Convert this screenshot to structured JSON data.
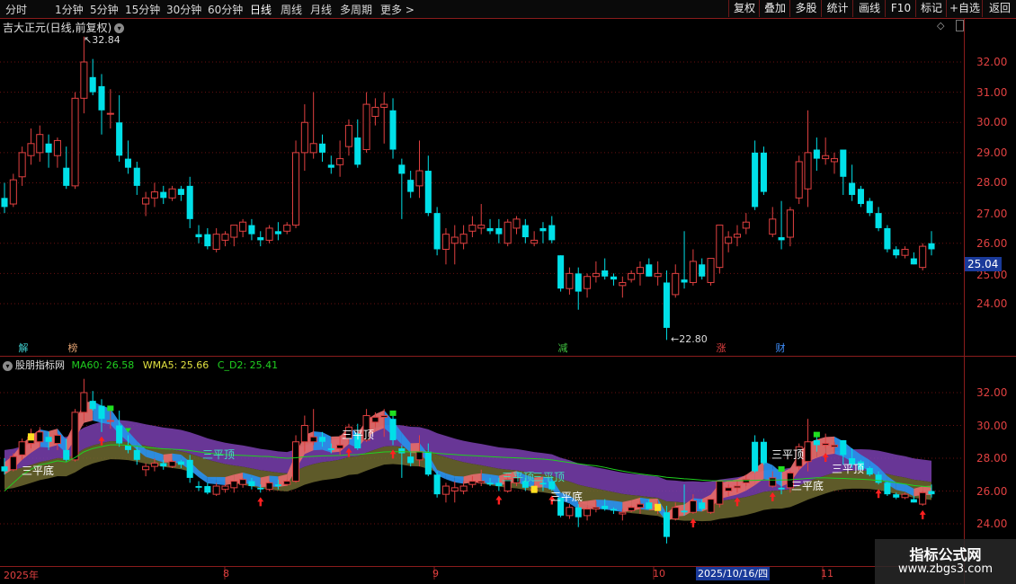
{
  "toolbar": {
    "timeframes": [
      "分时",
      "1分钟",
      "5分钟",
      "15分钟",
      "30分钟",
      "60分钟",
      "日线",
      "周线",
      "月线",
      "多周期",
      "更多"
    ],
    "more_arrow": ">",
    "buttons": [
      "复权",
      "叠加",
      "多股",
      "统计",
      "画线",
      "F10",
      "标记",
      "+自选",
      "返回"
    ]
  },
  "main_chart": {
    "title": "吉大正元(日线,前复权)",
    "current_price": "25.04",
    "high_label": "32.84",
    "low_label": "22.80",
    "price_ticks": [
      "32.00",
      "31.00",
      "30.00",
      "29.00",
      "28.00",
      "27.00",
      "26.00",
      "25.00",
      "24.00"
    ],
    "events": [
      {
        "label": "解",
        "color": "#40d0d0"
      },
      {
        "label": "榜",
        "color": "#e0a070"
      },
      {
        "label": "减",
        "color": "#40c040"
      },
      {
        "label": "涨",
        "color": "#e04040"
      },
      {
        "label": "财",
        "color": "#4090ff"
      }
    ]
  },
  "indicator": {
    "name": "股朋指标网",
    "ma60_label": "MA60: 26.58",
    "wma5_label": "WMA5: 25.66",
    "cd2_label": "C_D2: 25.41",
    "ma60_color": "#20d020",
    "wma5_color": "#e0e040",
    "cd2_color": "#20d020",
    "price_ticks": [
      "32.00",
      "30.00",
      "28.00",
      "26.00",
      "24.00"
    ],
    "annotations": [
      "三平底",
      "三平顶",
      "三平顶",
      "三平顶",
      "三平顶",
      "三平底",
      "三平顶",
      "三平底",
      "三平顶"
    ]
  },
  "date_axis": {
    "labels": [
      "2025年",
      "8",
      "9",
      "10",
      "11"
    ],
    "cursor_date": "2025/10/16/四"
  },
  "watermark": {
    "line1": "指标公式网",
    "line2": "www.zbgs3.com"
  },
  "chart_data": {
    "type": "candlestick",
    "up_color": "#e04040",
    "down_color": "#00e0e8",
    "ylim_main": [
      22.5,
      33.5
    ],
    "ylim_indicator": [
      22.5,
      34
    ],
    "candles": [
      {
        "o": 27.5,
        "h": 28.0,
        "l": 27.0,
        "c": 27.2
      },
      {
        "o": 27.3,
        "h": 28.3,
        "l": 27.2,
        "c": 28.1
      },
      {
        "o": 28.2,
        "h": 29.2,
        "l": 27.9,
        "c": 29.0
      },
      {
        "o": 28.9,
        "h": 29.8,
        "l": 28.6,
        "c": 29.3
      },
      {
        "o": 29.0,
        "h": 29.9,
        "l": 28.7,
        "c": 29.6
      },
      {
        "o": 29.3,
        "h": 29.6,
        "l": 28.5,
        "c": 29.0
      },
      {
        "o": 28.9,
        "h": 29.5,
        "l": 28.5,
        "c": 29.4
      },
      {
        "o": 28.5,
        "h": 29.2,
        "l": 27.8,
        "c": 27.9
      },
      {
        "o": 27.9,
        "h": 31.0,
        "l": 27.8,
        "c": 30.8
      },
      {
        "o": 30.8,
        "h": 32.84,
        "l": 30.3,
        "c": 32.0
      },
      {
        "o": 31.5,
        "h": 32.1,
        "l": 30.9,
        "c": 31.0
      },
      {
        "o": 31.2,
        "h": 31.6,
        "l": 29.6,
        "c": 30.4
      },
      {
        "o": 30.3,
        "h": 31.1,
        "l": 29.8,
        "c": 30.3
      },
      {
        "o": 30.0,
        "h": 30.9,
        "l": 28.7,
        "c": 28.9
      },
      {
        "o": 28.8,
        "h": 29.4,
        "l": 28.3,
        "c": 28.5
      },
      {
        "o": 28.5,
        "h": 28.7,
        "l": 27.6,
        "c": 27.9
      },
      {
        "o": 27.3,
        "h": 27.7,
        "l": 26.9,
        "c": 27.5
      },
      {
        "o": 27.5,
        "h": 28.0,
        "l": 27.2,
        "c": 27.7
      },
      {
        "o": 27.7,
        "h": 27.9,
        "l": 27.3,
        "c": 27.5
      },
      {
        "o": 27.5,
        "h": 27.9,
        "l": 27.4,
        "c": 27.8
      },
      {
        "o": 27.8,
        "h": 27.9,
        "l": 27.4,
        "c": 27.6
      },
      {
        "o": 27.9,
        "h": 28.2,
        "l": 26.5,
        "c": 26.8
      },
      {
        "o": 26.3,
        "h": 26.6,
        "l": 26.0,
        "c": 26.2
      },
      {
        "o": 26.3,
        "h": 26.5,
        "l": 25.8,
        "c": 25.9
      },
      {
        "o": 25.8,
        "h": 26.5,
        "l": 25.7,
        "c": 26.3
      },
      {
        "o": 26.1,
        "h": 26.4,
        "l": 25.9,
        "c": 26.3
      },
      {
        "o": 26.2,
        "h": 26.6,
        "l": 25.9,
        "c": 26.6
      },
      {
        "o": 26.4,
        "h": 26.8,
        "l": 26.2,
        "c": 26.7
      },
      {
        "o": 26.6,
        "h": 26.8,
        "l": 26.1,
        "c": 26.3
      },
      {
        "o": 26.2,
        "h": 26.4,
        "l": 25.9,
        "c": 26.1
      },
      {
        "o": 26.1,
        "h": 26.6,
        "l": 26.0,
        "c": 26.5
      },
      {
        "o": 26.4,
        "h": 26.7,
        "l": 26.1,
        "c": 26.3
      },
      {
        "o": 26.4,
        "h": 26.7,
        "l": 26.3,
        "c": 26.6
      },
      {
        "o": 26.6,
        "h": 29.4,
        "l": 26.5,
        "c": 29.0
      },
      {
        "o": 29.0,
        "h": 30.6,
        "l": 28.4,
        "c": 30.0
      },
      {
        "o": 29.0,
        "h": 31.0,
        "l": 28.8,
        "c": 29.3
      },
      {
        "o": 29.3,
        "h": 29.6,
        "l": 28.7,
        "c": 29.0
      },
      {
        "o": 28.6,
        "h": 28.9,
        "l": 28.3,
        "c": 28.5
      },
      {
        "o": 28.6,
        "h": 29.4,
        "l": 28.2,
        "c": 28.8
      },
      {
        "o": 29.2,
        "h": 30.1,
        "l": 28.9,
        "c": 29.9
      },
      {
        "o": 29.5,
        "h": 30.1,
        "l": 28.5,
        "c": 28.6
      },
      {
        "o": 29.1,
        "h": 31.0,
        "l": 29.0,
        "c": 30.6
      },
      {
        "o": 30.2,
        "h": 30.8,
        "l": 29.9,
        "c": 30.5
      },
      {
        "o": 30.5,
        "h": 31.0,
        "l": 29.3,
        "c": 30.6
      },
      {
        "o": 30.4,
        "h": 30.8,
        "l": 28.8,
        "c": 29.1
      },
      {
        "o": 28.6,
        "h": 28.8,
        "l": 26.8,
        "c": 28.3
      },
      {
        "o": 28.1,
        "h": 28.4,
        "l": 27.5,
        "c": 27.7
      },
      {
        "o": 27.9,
        "h": 29.4,
        "l": 27.5,
        "c": 28.4
      },
      {
        "o": 28.4,
        "h": 28.9,
        "l": 26.9,
        "c": 27.0
      },
      {
        "o": 27.0,
        "h": 27.2,
        "l": 25.6,
        "c": 25.8
      },
      {
        "o": 25.8,
        "h": 26.5,
        "l": 25.3,
        "c": 26.3
      },
      {
        "o": 26.0,
        "h": 26.6,
        "l": 25.3,
        "c": 26.2
      },
      {
        "o": 26.0,
        "h": 26.6,
        "l": 25.8,
        "c": 26.3
      },
      {
        "o": 26.4,
        "h": 26.9,
        "l": 26.2,
        "c": 26.6
      },
      {
        "o": 26.5,
        "h": 27.3,
        "l": 26.3,
        "c": 26.6
      },
      {
        "o": 26.5,
        "h": 26.8,
        "l": 26.3,
        "c": 26.4
      },
      {
        "o": 26.5,
        "h": 26.8,
        "l": 26.0,
        "c": 26.3
      },
      {
        "o": 26.0,
        "h": 26.8,
        "l": 25.9,
        "c": 26.7
      },
      {
        "o": 26.5,
        "h": 26.9,
        "l": 26.3,
        "c": 26.8
      },
      {
        "o": 26.6,
        "h": 26.8,
        "l": 26.0,
        "c": 26.2
      },
      {
        "o": 26.0,
        "h": 26.4,
        "l": 25.9,
        "c": 26.1
      },
      {
        "o": 26.5,
        "h": 26.7,
        "l": 26.0,
        "c": 26.4
      },
      {
        "o": 26.6,
        "h": 26.9,
        "l": 26.0,
        "c": 26.1
      },
      {
        "o": 25.6,
        "h": 25.6,
        "l": 24.4,
        "c": 24.5
      },
      {
        "o": 24.5,
        "h": 25.2,
        "l": 24.3,
        "c": 25.0
      },
      {
        "o": 25.0,
        "h": 25.2,
        "l": 23.8,
        "c": 24.4
      },
      {
        "o": 24.5,
        "h": 25.0,
        "l": 24.2,
        "c": 24.9
      },
      {
        "o": 24.9,
        "h": 25.4,
        "l": 24.7,
        "c": 25.0
      },
      {
        "o": 25.1,
        "h": 25.5,
        "l": 24.8,
        "c": 24.9
      },
      {
        "o": 24.9,
        "h": 25.0,
        "l": 24.6,
        "c": 24.8
      },
      {
        "o": 24.6,
        "h": 24.9,
        "l": 24.2,
        "c": 24.7
      },
      {
        "o": 24.8,
        "h": 25.1,
        "l": 24.7,
        "c": 25.0
      },
      {
        "o": 25.0,
        "h": 25.4,
        "l": 24.6,
        "c": 25.2
      },
      {
        "o": 25.3,
        "h": 25.5,
        "l": 24.9,
        "c": 24.9
      },
      {
        "o": 24.9,
        "h": 25.4,
        "l": 24.6,
        "c": 25.0
      },
      {
        "o": 24.7,
        "h": 25.1,
        "l": 22.8,
        "c": 23.2
      },
      {
        "o": 24.3,
        "h": 25.3,
        "l": 24.2,
        "c": 25.0
      },
      {
        "o": 24.8,
        "h": 26.4,
        "l": 24.5,
        "c": 24.7
      },
      {
        "o": 24.7,
        "h": 25.8,
        "l": 24.6,
        "c": 25.4
      },
      {
        "o": 25.3,
        "h": 25.5,
        "l": 24.8,
        "c": 24.9
      },
      {
        "o": 24.7,
        "h": 25.4,
        "l": 24.6,
        "c": 25.5
      },
      {
        "o": 25.2,
        "h": 26.6,
        "l": 25.0,
        "c": 26.6
      },
      {
        "o": 26.0,
        "h": 26.4,
        "l": 25.7,
        "c": 26.2
      },
      {
        "o": 26.2,
        "h": 26.6,
        "l": 25.9,
        "c": 26.3
      },
      {
        "o": 26.5,
        "h": 27.0,
        "l": 26.3,
        "c": 26.7
      },
      {
        "o": 29.0,
        "h": 29.4,
        "l": 27.1,
        "c": 27.2
      },
      {
        "o": 29.0,
        "h": 29.2,
        "l": 27.6,
        "c": 27.7
      },
      {
        "o": 26.3,
        "h": 27.2,
        "l": 26.2,
        "c": 26.8
      },
      {
        "o": 26.2,
        "h": 27.4,
        "l": 25.8,
        "c": 26.1
      },
      {
        "o": 26.2,
        "h": 27.2,
        "l": 25.9,
        "c": 27.1
      },
      {
        "o": 27.5,
        "h": 28.9,
        "l": 27.3,
        "c": 28.7
      },
      {
        "o": 27.8,
        "h": 30.4,
        "l": 27.2,
        "c": 29.0
      },
      {
        "o": 29.1,
        "h": 29.5,
        "l": 28.4,
        "c": 28.8
      },
      {
        "o": 28.8,
        "h": 29.5,
        "l": 28.6,
        "c": 28.9
      },
      {
        "o": 28.7,
        "h": 29.0,
        "l": 28.3,
        "c": 28.8
      },
      {
        "o": 29.1,
        "h": 29.1,
        "l": 27.6,
        "c": 28.2
      },
      {
        "o": 28.0,
        "h": 28.6,
        "l": 27.4,
        "c": 27.6
      },
      {
        "o": 27.8,
        "h": 27.9,
        "l": 27.2,
        "c": 27.3
      },
      {
        "o": 27.4,
        "h": 27.5,
        "l": 26.9,
        "c": 27.0
      },
      {
        "o": 27.0,
        "h": 27.2,
        "l": 26.4,
        "c": 26.5
      },
      {
        "o": 26.5,
        "h": 26.6,
        "l": 25.7,
        "c": 25.8
      },
      {
        "o": 25.8,
        "h": 25.9,
        "l": 25.5,
        "c": 25.6
      },
      {
        "o": 25.6,
        "h": 25.9,
        "l": 25.5,
        "c": 25.8
      },
      {
        "o": 25.5,
        "h": 25.7,
        "l": 25.3,
        "c": 25.3
      },
      {
        "o": 25.2,
        "h": 26.0,
        "l": 25.1,
        "c": 25.9
      },
      {
        "o": 26.0,
        "h": 26.4,
        "l": 25.6,
        "c": 25.8
      }
    ]
  }
}
